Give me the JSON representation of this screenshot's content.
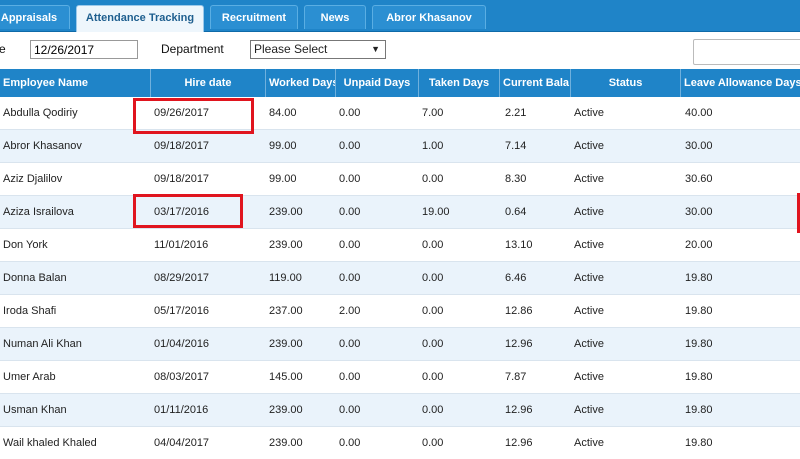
{
  "tabs": [
    {
      "label": "Appraisals"
    },
    {
      "label": "Attendance Tracking"
    },
    {
      "label": "Recruitment"
    },
    {
      "label": "News"
    },
    {
      "label": "Abror Khasanov"
    }
  ],
  "filter": {
    "date_label": "e",
    "date_value": "12/26/2017",
    "department_label": "Department",
    "department_value": "Please Select",
    "caret": "▼"
  },
  "columns": [
    "Employee Name",
    "Hire date",
    "Worked Days",
    "Unpaid Days",
    "Taken Days",
    "Current Bala",
    "Status",
    "Leave Allowance Days"
  ],
  "rows": [
    [
      "Abdulla Qodiriy",
      "09/26/2017",
      "84.00",
      "0.00",
      "7.00",
      "2.21",
      "Active",
      "40.00"
    ],
    [
      "Abror Khasanov",
      "09/18/2017",
      "99.00",
      "0.00",
      "1.00",
      "7.14",
      "Active",
      "30.00"
    ],
    [
      "Aziz Djalilov",
      "09/18/2017",
      "99.00",
      "0.00",
      "0.00",
      "8.30",
      "Active",
      "30.60"
    ],
    [
      "Aziza Israilova",
      "03/17/2016",
      "239.00",
      "0.00",
      "19.00",
      "0.64",
      "Active",
      "30.00"
    ],
    [
      "Don York",
      "11/01/2016",
      "239.00",
      "0.00",
      "0.00",
      "13.10",
      "Active",
      "20.00"
    ],
    [
      "Donna Balan",
      "08/29/2017",
      "119.00",
      "0.00",
      "0.00",
      "6.46",
      "Active",
      "19.80"
    ],
    [
      "Iroda Shafi",
      "05/17/2016",
      "237.00",
      "2.00",
      "0.00",
      "12.86",
      "Active",
      "19.80"
    ],
    [
      "Numan Ali Khan",
      "01/04/2016",
      "239.00",
      "0.00",
      "0.00",
      "12.96",
      "Active",
      "19.80"
    ],
    [
      "Umer Arab",
      "08/03/2017",
      "145.00",
      "0.00",
      "0.00",
      "7.87",
      "Active",
      "19.80"
    ],
    [
      "Usman Khan",
      "01/11/2016",
      "239.00",
      "0.00",
      "0.00",
      "12.96",
      "Active",
      "19.80"
    ],
    [
      "Wail khaled Khaled",
      "04/04/2017",
      "239.00",
      "0.00",
      "0.00",
      "12.96",
      "Active",
      "19.80"
    ]
  ]
}
